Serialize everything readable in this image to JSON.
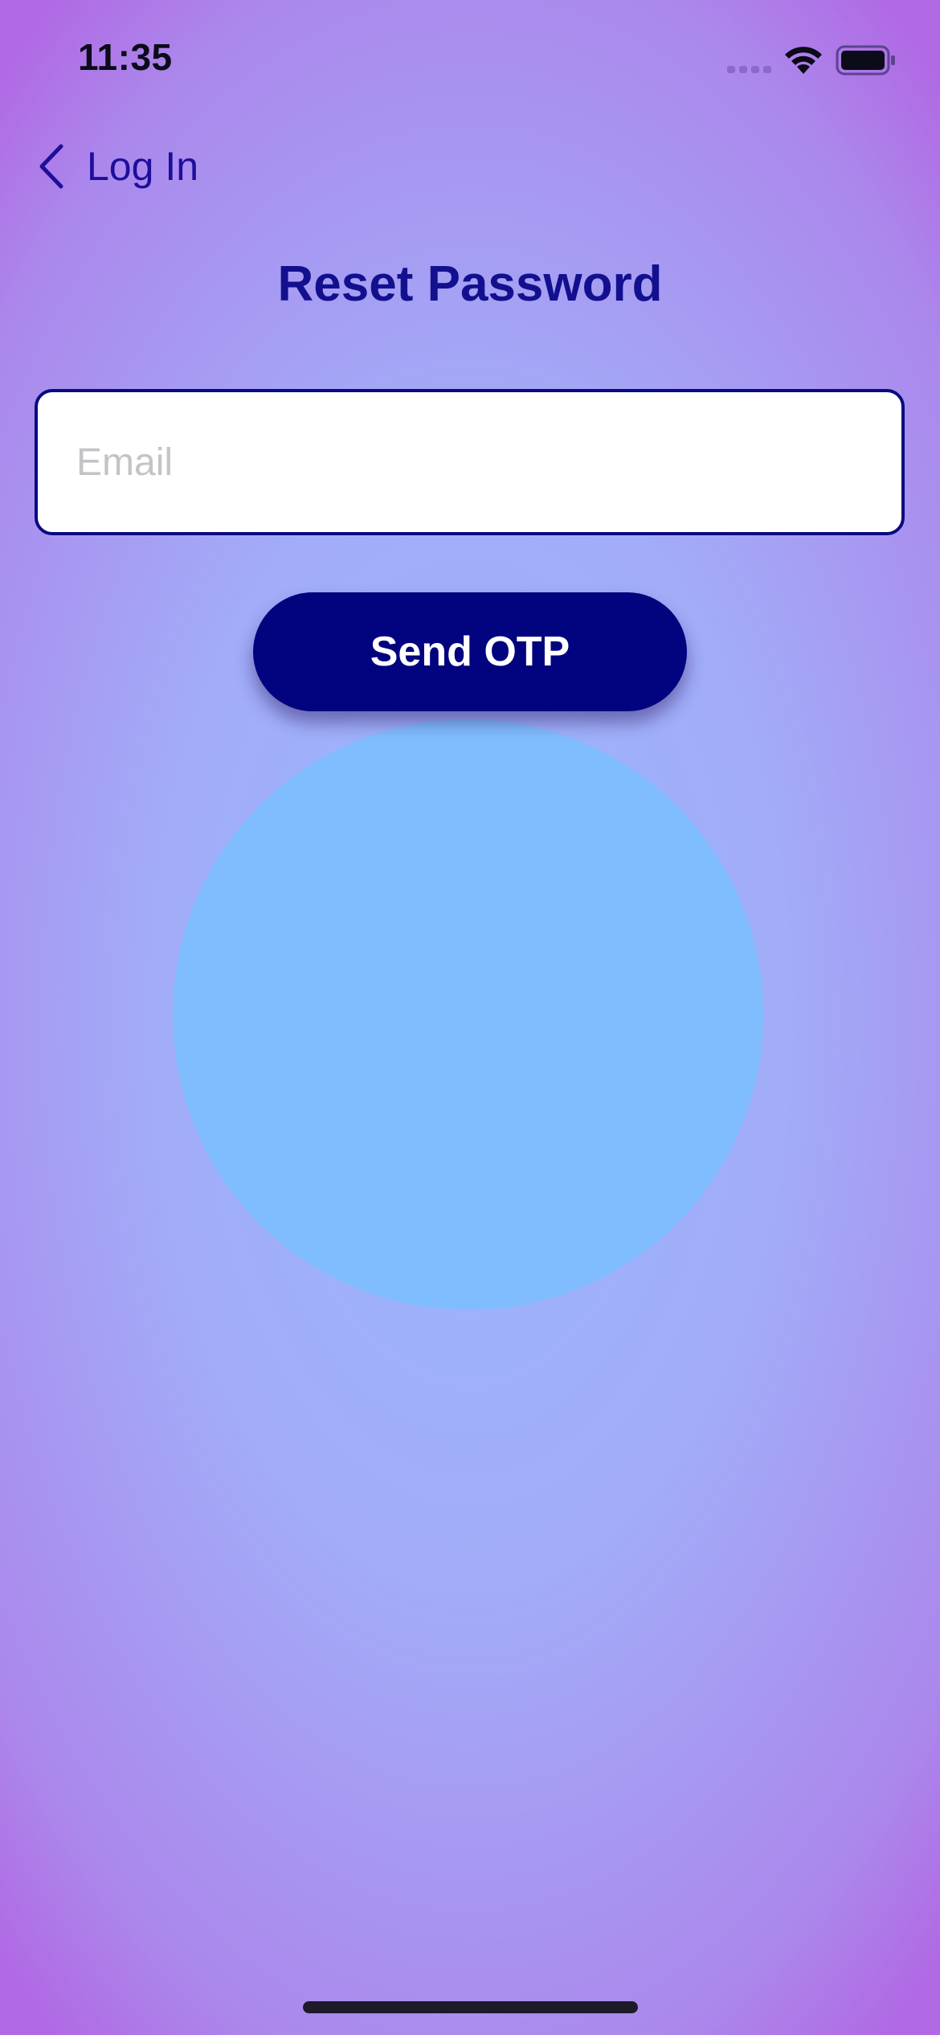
{
  "status_bar": {
    "time": "11:35",
    "icons": [
      "signal-icon",
      "wifi-icon",
      "battery-icon"
    ]
  },
  "nav": {
    "back_label": "Log In",
    "back_icon": "chevron-left-icon"
  },
  "page": {
    "title": "Reset Password"
  },
  "form": {
    "email_placeholder": "Email",
    "email_value": "",
    "submit_label": "Send OTP"
  },
  "colors": {
    "accent": "#01037f",
    "title": "#13108f",
    "link": "#1e0e9c",
    "background_edge": "#b169e4",
    "background_center": "#9bb6fd",
    "blob": "#80bdfe"
  }
}
